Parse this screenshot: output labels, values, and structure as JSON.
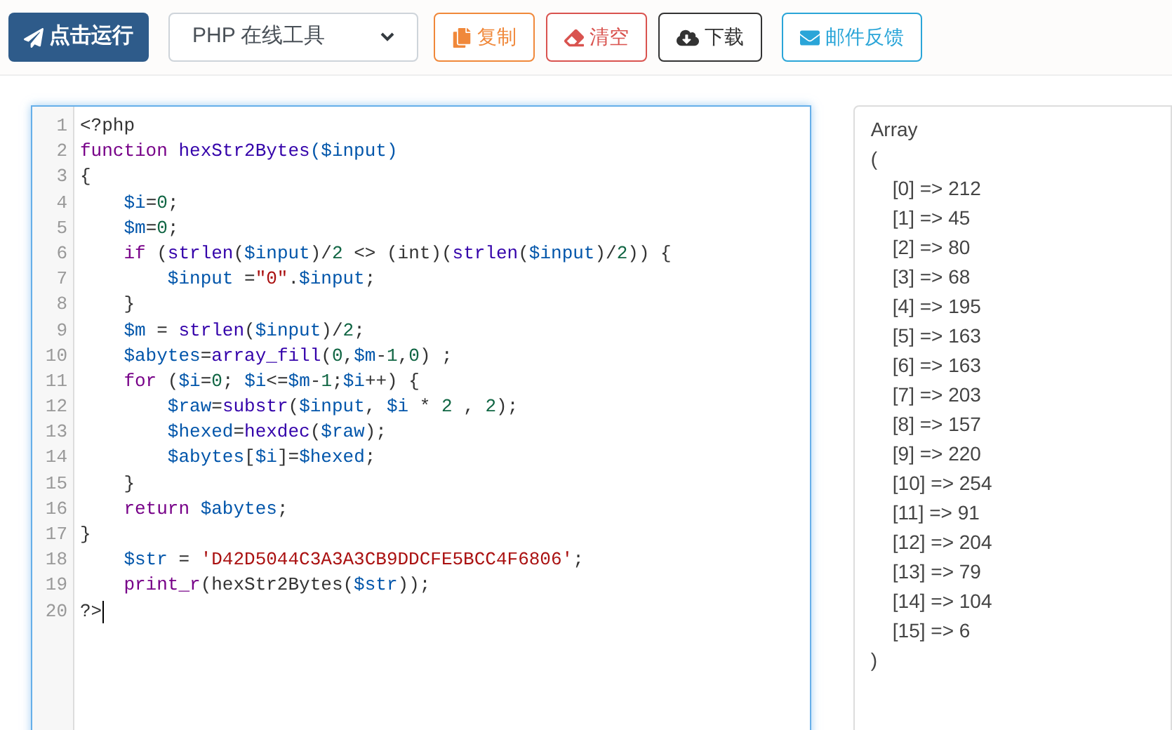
{
  "toolbar": {
    "run_button": "点击运行",
    "language_select": {
      "value": "PHP 在线工具"
    },
    "buttons": [
      {
        "kind": "copy",
        "label": "复制"
      },
      {
        "kind": "clear",
        "label": "清空"
      },
      {
        "kind": "download",
        "label": "下载"
      },
      {
        "kind": "email",
        "label": "邮件反馈"
      }
    ]
  },
  "editor": {
    "lines": [
      {
        "number": "1",
        "tokens": [
          {
            "kind": "plain",
            "text": "<?php"
          }
        ]
      },
      {
        "number": "2",
        "tokens": [
          {
            "kind": "keyword",
            "text": "function "
          },
          {
            "kind": "function",
            "text": "hexStr2Bytes"
          },
          {
            "kind": "variable",
            "text": "($input)"
          }
        ]
      },
      {
        "number": "3",
        "tokens": [
          {
            "kind": "plain",
            "text": "{"
          }
        ]
      },
      {
        "number": "4",
        "tokens": [
          {
            "kind": "variable",
            "text": "    $i"
          },
          {
            "kind": "plain",
            "text": "="
          },
          {
            "kind": "number",
            "text": "0"
          },
          {
            "kind": "plain",
            "text": ";"
          }
        ]
      },
      {
        "number": "5",
        "tokens": [
          {
            "kind": "variable",
            "text": "    $m"
          },
          {
            "kind": "plain",
            "text": "="
          },
          {
            "kind": "number",
            "text": "0"
          },
          {
            "kind": "plain",
            "text": ";"
          }
        ]
      },
      {
        "number": "6",
        "tokens": [
          {
            "kind": "keyword",
            "text": "    if"
          },
          {
            "kind": "plain",
            "text": " ("
          },
          {
            "kind": "function",
            "text": "strlen"
          },
          {
            "kind": "plain",
            "text": "("
          },
          {
            "kind": "variable",
            "text": "$input"
          },
          {
            "kind": "plain",
            "text": ")/"
          },
          {
            "kind": "number",
            "text": "2"
          },
          {
            "kind": "plain",
            "text": " <> (int)("
          },
          {
            "kind": "function",
            "text": "strlen"
          },
          {
            "kind": "plain",
            "text": "("
          },
          {
            "kind": "variable",
            "text": "$input"
          },
          {
            "kind": "plain",
            "text": ")/"
          },
          {
            "kind": "number",
            "text": "2"
          },
          {
            "kind": "plain",
            "text": ")) {"
          }
        ]
      },
      {
        "number": "7",
        "tokens": [
          {
            "kind": "variable",
            "text": "        $input"
          },
          {
            "kind": "plain",
            "text": " ="
          },
          {
            "kind": "string",
            "text": "\"0\""
          },
          {
            "kind": "plain",
            "text": "."
          },
          {
            "kind": "variable",
            "text": "$input"
          },
          {
            "kind": "plain",
            "text": ";"
          }
        ]
      },
      {
        "number": "8",
        "tokens": [
          {
            "kind": "plain",
            "text": "    }"
          }
        ]
      },
      {
        "number": "9",
        "tokens": [
          {
            "kind": "variable",
            "text": "    $m"
          },
          {
            "kind": "plain",
            "text": " = "
          },
          {
            "kind": "function",
            "text": "strlen"
          },
          {
            "kind": "plain",
            "text": "("
          },
          {
            "kind": "variable",
            "text": "$input"
          },
          {
            "kind": "plain",
            "text": ")/"
          },
          {
            "kind": "number",
            "text": "2"
          },
          {
            "kind": "plain",
            "text": ";"
          }
        ]
      },
      {
        "number": "10",
        "tokens": [
          {
            "kind": "variable",
            "text": "    $abytes"
          },
          {
            "kind": "plain",
            "text": "="
          },
          {
            "kind": "function",
            "text": "array_fill"
          },
          {
            "kind": "plain",
            "text": "("
          },
          {
            "kind": "number",
            "text": "0"
          },
          {
            "kind": "plain",
            "text": ","
          },
          {
            "kind": "variable",
            "text": "$m"
          },
          {
            "kind": "plain",
            "text": "-"
          },
          {
            "kind": "number",
            "text": "1"
          },
          {
            "kind": "plain",
            "text": ","
          },
          {
            "kind": "number",
            "text": "0"
          },
          {
            "kind": "plain",
            "text": ") ;"
          }
        ]
      },
      {
        "number": "11",
        "tokens": [
          {
            "kind": "keyword",
            "text": "    for"
          },
          {
            "kind": "plain",
            "text": " ("
          },
          {
            "kind": "variable",
            "text": "$i"
          },
          {
            "kind": "plain",
            "text": "="
          },
          {
            "kind": "number",
            "text": "0"
          },
          {
            "kind": "plain",
            "text": "; "
          },
          {
            "kind": "variable",
            "text": "$i"
          },
          {
            "kind": "plain",
            "text": "<="
          },
          {
            "kind": "variable",
            "text": "$m"
          },
          {
            "kind": "plain",
            "text": "-"
          },
          {
            "kind": "number",
            "text": "1"
          },
          {
            "kind": "plain",
            "text": ";"
          },
          {
            "kind": "variable",
            "text": "$i"
          },
          {
            "kind": "plain",
            "text": "++) {"
          }
        ]
      },
      {
        "number": "12",
        "tokens": [
          {
            "kind": "variable",
            "text": "        $raw"
          },
          {
            "kind": "plain",
            "text": "="
          },
          {
            "kind": "function",
            "text": "substr"
          },
          {
            "kind": "plain",
            "text": "("
          },
          {
            "kind": "variable",
            "text": "$input"
          },
          {
            "kind": "plain",
            "text": ", "
          },
          {
            "kind": "variable",
            "text": "$i"
          },
          {
            "kind": "plain",
            "text": " * "
          },
          {
            "kind": "number",
            "text": "2"
          },
          {
            "kind": "plain",
            "text": " , "
          },
          {
            "kind": "number",
            "text": "2"
          },
          {
            "kind": "plain",
            "text": ");"
          }
        ]
      },
      {
        "number": "13",
        "tokens": [
          {
            "kind": "variable",
            "text": "        $hexed"
          },
          {
            "kind": "plain",
            "text": "="
          },
          {
            "kind": "function",
            "text": "hexdec"
          },
          {
            "kind": "plain",
            "text": "("
          },
          {
            "kind": "variable",
            "text": "$raw"
          },
          {
            "kind": "plain",
            "text": ");"
          }
        ]
      },
      {
        "number": "14",
        "tokens": [
          {
            "kind": "variable",
            "text": "        $abytes"
          },
          {
            "kind": "plain",
            "text": "["
          },
          {
            "kind": "variable",
            "text": "$i"
          },
          {
            "kind": "plain",
            "text": "]="
          },
          {
            "kind": "variable",
            "text": "$hexed"
          },
          {
            "kind": "plain",
            "text": ";"
          }
        ]
      },
      {
        "number": "15",
        "tokens": [
          {
            "kind": "plain",
            "text": "    }"
          }
        ]
      },
      {
        "number": "16",
        "tokens": [
          {
            "kind": "keyword",
            "text": "    return"
          },
          {
            "kind": "variable",
            "text": " $abytes"
          },
          {
            "kind": "plain",
            "text": ";"
          }
        ]
      },
      {
        "number": "17",
        "tokens": [
          {
            "kind": "plain",
            "text": "}"
          }
        ]
      },
      {
        "number": "18",
        "tokens": [
          {
            "kind": "variable",
            "text": "    $str"
          },
          {
            "kind": "plain",
            "text": " = "
          },
          {
            "kind": "string",
            "text": "'D42D5044C3A3A3CB9DDCFE5BCC4F6806'"
          },
          {
            "kind": "plain",
            "text": ";"
          }
        ]
      },
      {
        "number": "19",
        "tokens": [
          {
            "kind": "keyword",
            "text": "    print_r"
          },
          {
            "kind": "plain",
            "text": "(hexStr2Bytes("
          },
          {
            "kind": "variable",
            "text": "$str"
          },
          {
            "kind": "plain",
            "text": "));"
          }
        ]
      },
      {
        "number": "20",
        "tokens": [
          {
            "kind": "plain",
            "text": "?>"
          }
        ]
      }
    ]
  },
  "output": {
    "lines": [
      "Array",
      "(",
      "    [0] => 212",
      "    [1] => 45",
      "    [2] => 80",
      "    [3] => 68",
      "    [4] => 195",
      "    [5] => 163",
      "    [6] => 163",
      "    [7] => 203",
      "    [8] => 157",
      "    [9] => 220",
      "    [10] => 254",
      "    [11] => 91",
      "    [12] => 204",
      "    [13] => 79",
      "    [14] => 104",
      "    [15] => 6",
      ")"
    ]
  }
}
